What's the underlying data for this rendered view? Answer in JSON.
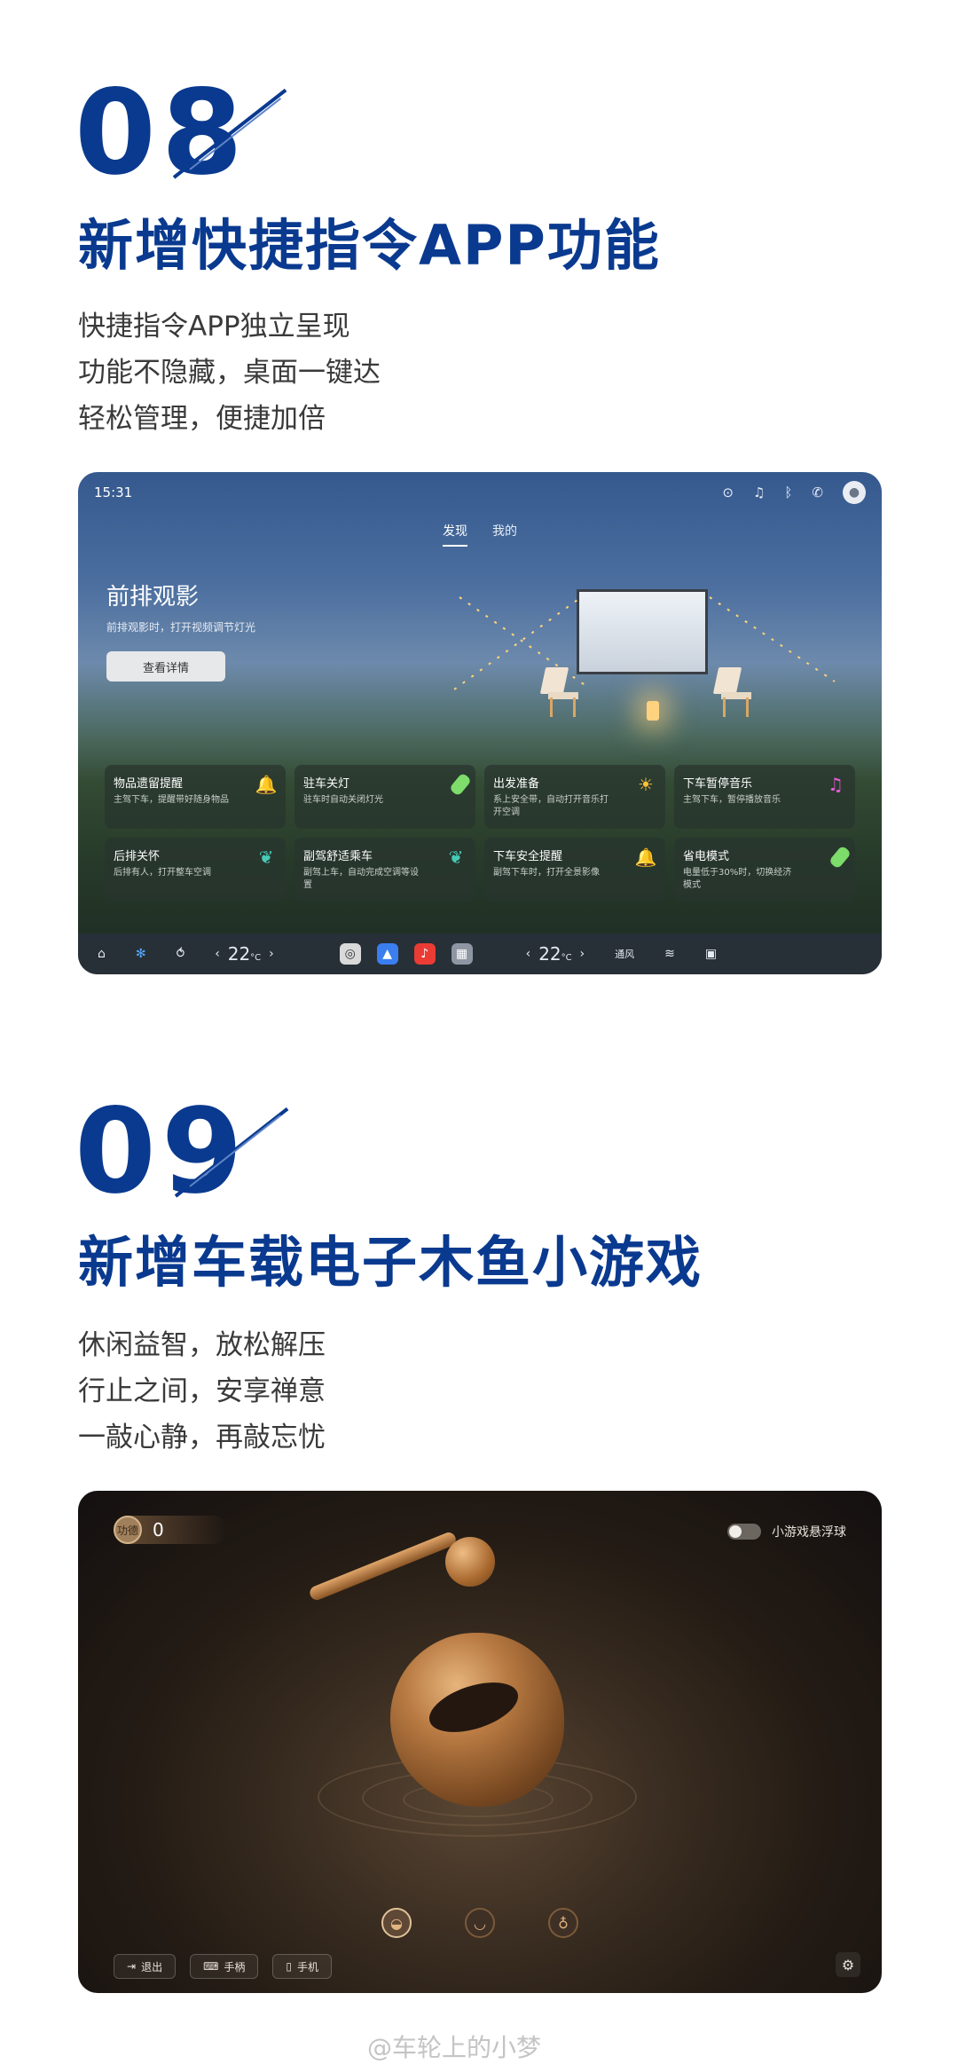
{
  "section1": {
    "number": "08",
    "title": "新增快捷指令APP功能",
    "desc": [
      "快捷指令APP独立呈现",
      "功能不隐藏，桌面一键达",
      "轻松管理，便捷加倍"
    ]
  },
  "screen1": {
    "time": "15:31",
    "status_icons": [
      "location-icon",
      "bell-icon",
      "bluetooth-icon",
      "phone-icon",
      "avatar-icon"
    ],
    "tabs": [
      "发现",
      "我的"
    ],
    "active_tab": "发现",
    "hero": {
      "title": "前排观影",
      "subtitle": "前排观影时，打开视频调节灯光",
      "button": "查看详情"
    },
    "cards": [
      {
        "title": "物品遗留提醒",
        "sub": "主驾下车，提醒带好随身物品",
        "icon": "bell-icon",
        "color": "#ff8a4a"
      },
      {
        "title": "驻车关灯",
        "sub": "驻车时自动关闭灯光",
        "icon": "battery-icon",
        "color": "#7ddc6a"
      },
      {
        "title": "出发准备",
        "sub": "系上安全带，自动打开音乐打开空调",
        "icon": "sun-icon",
        "color": "#ffc23a"
      },
      {
        "title": "下车暂停音乐",
        "sub": "主驾下车，暂停播放音乐",
        "icon": "music-icon",
        "color": "#e85bd8"
      },
      {
        "title": "后排关怀",
        "sub": "后排有人，打开整车空调",
        "icon": "leaf-icon",
        "color": "#47c9b6"
      },
      {
        "title": "副驾舒适乘车",
        "sub": "副驾上车，自动完成空调等设置",
        "icon": "leaf-icon",
        "color": "#47c9b6"
      },
      {
        "title": "下车安全提醒",
        "sub": "副驾下车时，打开全景影像",
        "icon": "bell-icon",
        "color": "#ff8a4a"
      },
      {
        "title": "省电模式",
        "sub": "电量低于30%时，切换经济模式",
        "icon": "battery-icon",
        "color": "#7ddc6a"
      }
    ],
    "dock": {
      "temp_left": "22",
      "temp_right": "22",
      "temp_unit": "°C",
      "vent_label": "通风",
      "apps": [
        {
          "name": "steering-app-icon",
          "color": "#d9d9d9"
        },
        {
          "name": "navigation-app-icon",
          "color": "#3a7ef0"
        },
        {
          "name": "music-app-icon",
          "color": "#ea3c34"
        },
        {
          "name": "apps-grid-icon",
          "color": "#8f96a3"
        }
      ]
    }
  },
  "section2": {
    "number": "09",
    "title": "新增车载电子木鱼小游戏",
    "desc": [
      "休闲益智，放松解压",
      "行止之间，安享禅意",
      "一敲心静，再敲忘忧"
    ]
  },
  "screen2": {
    "badge_text": "功德",
    "counter": "0",
    "toggle_label": "小游戏悬浮球",
    "toggle_on": false,
    "choices": [
      "wooden-fish-icon",
      "bowl-icon",
      "bell-icon"
    ],
    "active_choice": 0,
    "buttons": [
      "退出",
      "手柄",
      "手机"
    ]
  },
  "watermark": "@车轮上的小梦"
}
